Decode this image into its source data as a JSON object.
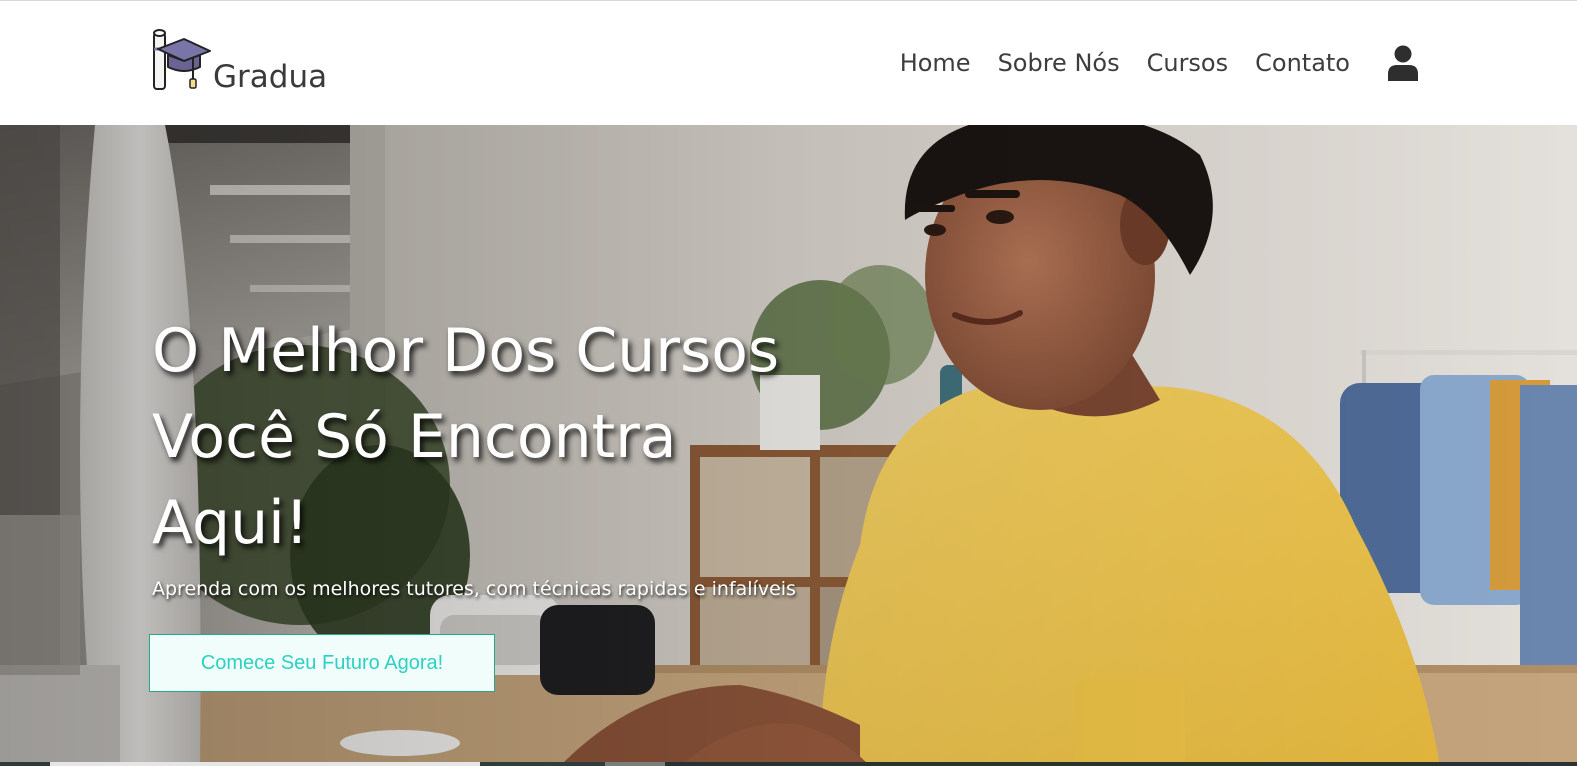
{
  "brand": {
    "name": "Gradua",
    "logo_icon": "graduation-cap-diploma-icon"
  },
  "nav": {
    "items": [
      {
        "label": "Home"
      },
      {
        "label": "Sobre Nós"
      },
      {
        "label": "Cursos"
      },
      {
        "label": "Contato"
      }
    ],
    "user_icon": "user-icon"
  },
  "hero": {
    "title_lines": [
      "O Melhor Dos Cursos",
      "Você Só Encontra",
      "Aqui!"
    ],
    "subtitle": "Aprenda com os melhores tutores, com técnicas rapidas e infalíveis",
    "cta_label": "Comece Seu Futuro Agora!"
  },
  "colors": {
    "cta_text": "#2bd1c4",
    "cta_border": "#29a889",
    "cta_bg": "#f1fdfb",
    "shirt": "#f2c94c",
    "nav_text": "#3d3d3d"
  }
}
